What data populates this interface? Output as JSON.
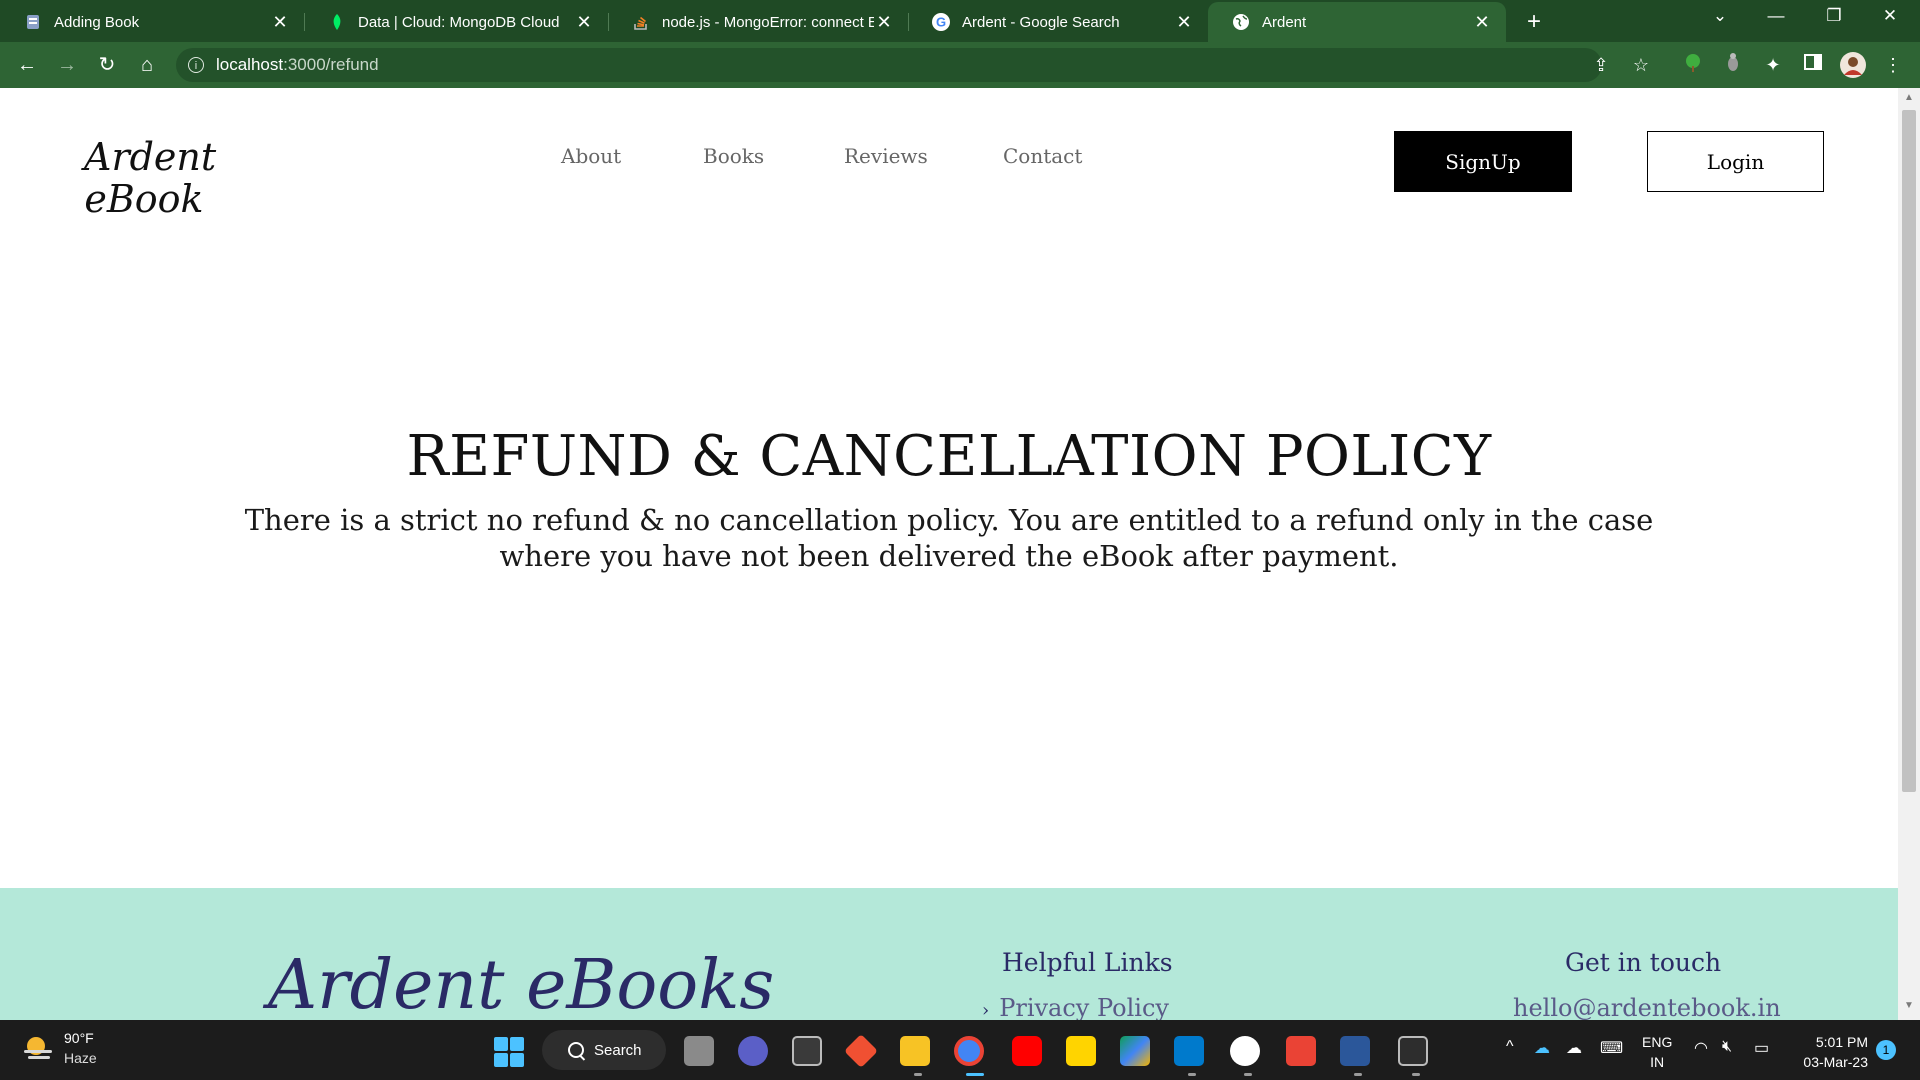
{
  "browser": {
    "tabs": [
      {
        "title": "Adding Book",
        "icon": "notebook-icon"
      },
      {
        "title": "Data | Cloud: MongoDB Cloud",
        "icon": "mongodb-leaf-icon"
      },
      {
        "title": "node.js - MongoError: connect EC",
        "icon": "stackoverflow-icon"
      },
      {
        "title": "Ardent - Google Search",
        "icon": "google-icon"
      },
      {
        "title": "Ardent",
        "icon": "globe-icon",
        "active": true
      }
    ],
    "new_tab": "+",
    "address": {
      "host": "localhost",
      "path": ":3000/refund"
    }
  },
  "site": {
    "logo": {
      "line1": "Ardent",
      "line2": "eBook"
    },
    "nav": [
      "About",
      "Books",
      "Reviews",
      "Contact"
    ],
    "signup_label": "SignUp",
    "login_label": "Login"
  },
  "content": {
    "title": "REFUND & CANCELLATION POLICY",
    "body": "There is a strict no refund & no cancellation policy. You are entitled to a refund only in the case where you have not been delivered the eBook after payment."
  },
  "footer": {
    "brand": "Ardent eBooks",
    "helpful_heading": "Helpful Links",
    "helpful_links": [
      "Privacy Policy"
    ],
    "contact_heading": "Get in touch",
    "email": "hello@ardentebook.in"
  },
  "taskbar": {
    "weather": {
      "temp": "90°F",
      "condition": "Haze"
    },
    "search_label": "Search",
    "language": {
      "line1": "ENG",
      "line2": "IN"
    },
    "clock": {
      "time": "5:01 PM",
      "date": "03-Mar-23"
    },
    "notification_count": "1"
  },
  "colors": {
    "chrome_frame": "#1f4a25",
    "chrome_toolbar": "#2e6434",
    "footer_bg": "#b4e8d9",
    "footer_text": "#2a2a66",
    "taskbar": "#1c1c1c"
  }
}
